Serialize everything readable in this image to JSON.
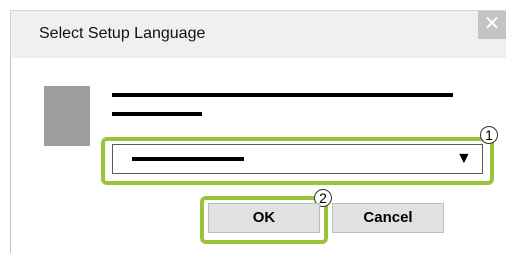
{
  "dialog": {
    "title": "Select Setup Language",
    "close_glyph": "✕",
    "language_select": {
      "arrow_glyph": "▼",
      "icon": "dropdown-arrow-icon"
    },
    "callouts": [
      "1",
      "2"
    ],
    "buttons": {
      "ok_label": "OK",
      "cancel_label": "Cancel"
    },
    "colors": {
      "highlight": "#9ac33c",
      "titlebar": "#f0f0f0",
      "close_button": "#c4c4c4",
      "button_face": "#e1e1e1",
      "app_icon": "#9e9e9e"
    }
  }
}
